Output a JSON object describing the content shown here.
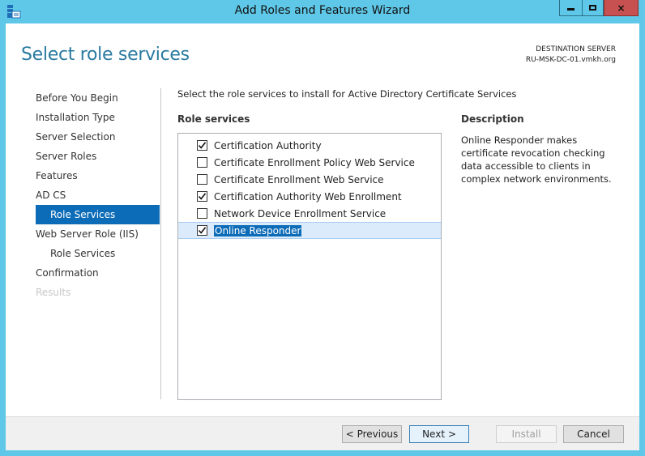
{
  "window": {
    "title": "Add Roles and Features Wizard",
    "controls": {
      "minimize": "minimize-icon",
      "maximize": "maximize-icon",
      "close": "×"
    }
  },
  "header": {
    "page_title": "Select role services",
    "destination_label": "DESTINATION SERVER",
    "destination_server": "RU-MSK-DC-01.vmkh.org"
  },
  "nav": {
    "items": [
      {
        "label": "Before You Begin",
        "state": "normal",
        "indent": false
      },
      {
        "label": "Installation Type",
        "state": "normal",
        "indent": false
      },
      {
        "label": "Server Selection",
        "state": "normal",
        "indent": false
      },
      {
        "label": "Server Roles",
        "state": "normal",
        "indent": false
      },
      {
        "label": "Features",
        "state": "normal",
        "indent": false
      },
      {
        "label": "AD CS",
        "state": "normal",
        "indent": false
      },
      {
        "label": "Role Services",
        "state": "active",
        "indent": true
      },
      {
        "label": "Web Server Role (IIS)",
        "state": "normal",
        "indent": false
      },
      {
        "label": "Role Services",
        "state": "normal",
        "indent": true
      },
      {
        "label": "Confirmation",
        "state": "normal",
        "indent": false
      },
      {
        "label": "Results",
        "state": "disabled",
        "indent": false
      }
    ]
  },
  "main": {
    "intro": "Select the role services to install for Active Directory Certificate Services",
    "role_services_label": "Role services",
    "role_services": [
      {
        "label": "Certification Authority",
        "checked": true,
        "selected": false
      },
      {
        "label": "Certificate Enrollment Policy Web Service",
        "checked": false,
        "selected": false
      },
      {
        "label": "Certificate Enrollment Web Service",
        "checked": false,
        "selected": false
      },
      {
        "label": "Certification Authority Web Enrollment",
        "checked": true,
        "selected": false
      },
      {
        "label": "Network Device Enrollment Service",
        "checked": false,
        "selected": false
      },
      {
        "label": "Online Responder",
        "checked": true,
        "selected": true
      }
    ],
    "description_label": "Description",
    "description_text": "Online Responder makes certificate revocation checking data accessible to clients in complex network environments."
  },
  "footer": {
    "previous": "< Previous",
    "next": "Next >",
    "install": "Install",
    "cancel": "Cancel"
  },
  "colors": {
    "accent": "#0d6cb8",
    "title_bar": "#5fc8e8",
    "close_button": "#c75050",
    "page_title": "#2a7aa0"
  }
}
